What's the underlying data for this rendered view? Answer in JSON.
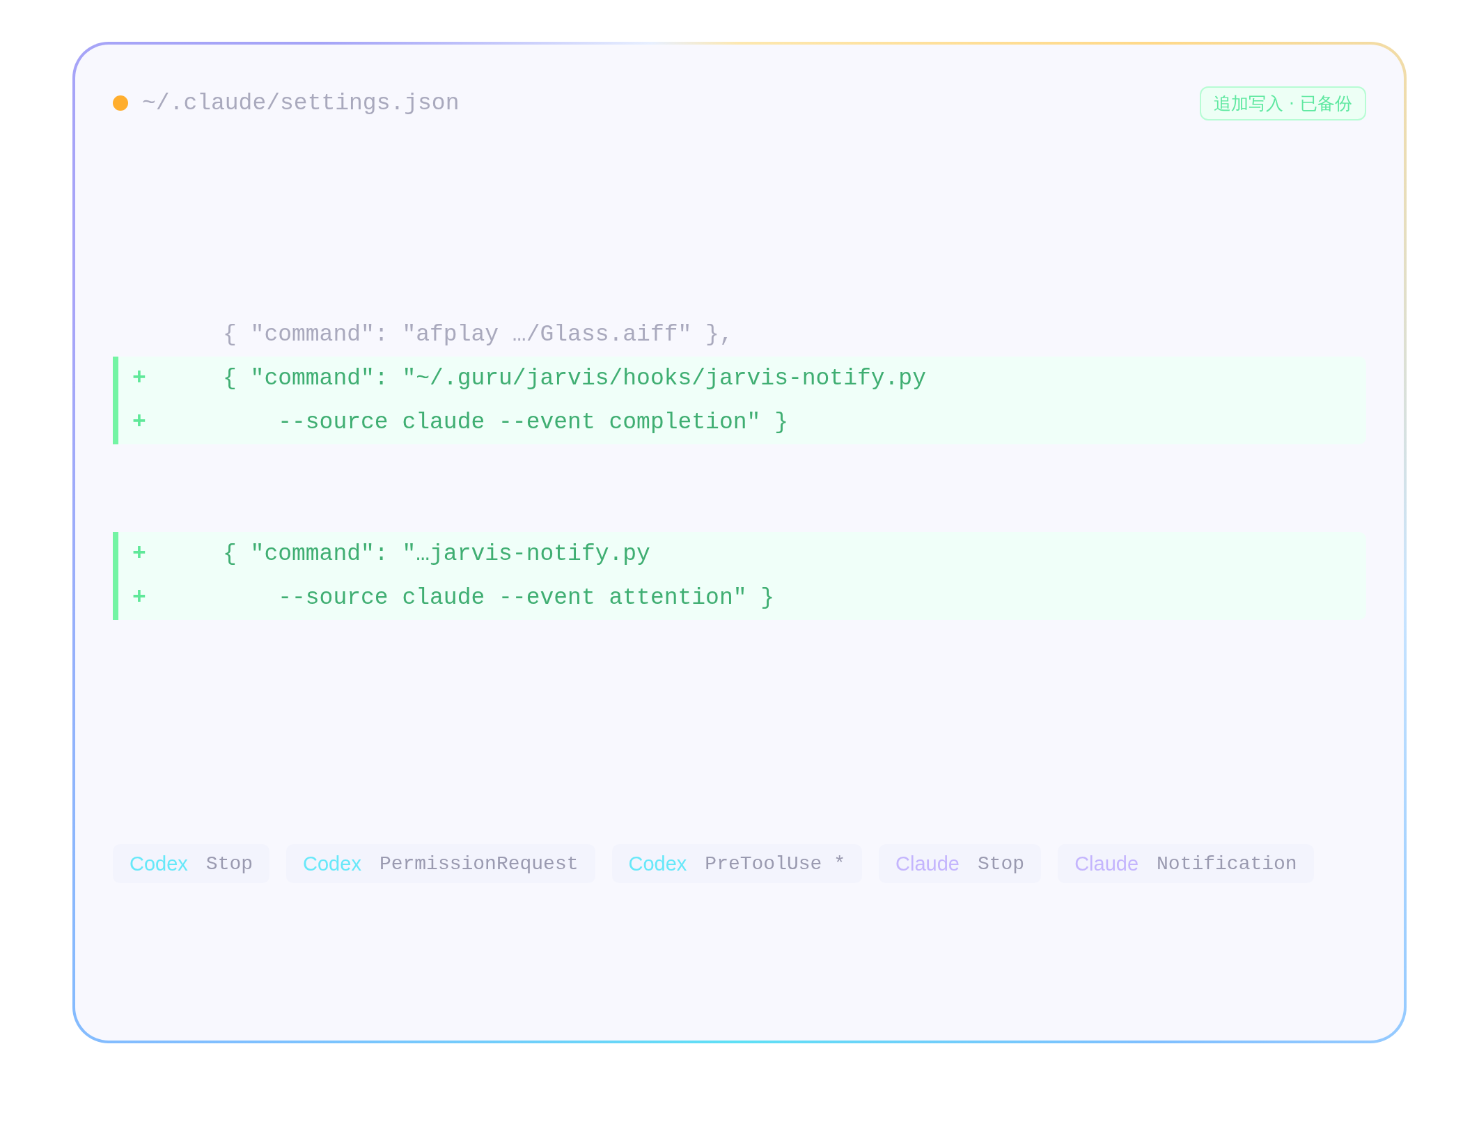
{
  "file": {
    "path": "~/.claude/settings.json"
  },
  "badge": "追加写入 · 已备份",
  "code_blocks": [
    {
      "kind": "context",
      "lines": [
        {
          "text": "{ \"command\": \"afplay …/Glass.aiff\" },"
        }
      ]
    },
    {
      "kind": "added",
      "lines": [
        {
          "marker": "+",
          "text": "{ \"command\": \"~/.guru/jarvis/hooks/jarvis-notify.py"
        },
        {
          "marker": "+",
          "text": "    --source claude --event completion\" }"
        }
      ]
    },
    {
      "kind": "added",
      "lines": [
        {
          "marker": "+",
          "text": "{ \"command\": \"…jarvis-notify.py"
        },
        {
          "marker": "+",
          "text": "    --source claude --event attention\" }"
        }
      ]
    }
  ],
  "events": [
    {
      "source": "Codex",
      "color": "#67e8f9",
      "event": "Stop"
    },
    {
      "source": "Codex",
      "color": "#67e8f9",
      "event": "PermissionRequest"
    },
    {
      "source": "Codex",
      "color": "#67e8f9",
      "event": "PreToolUse *"
    },
    {
      "source": "Claude",
      "color": "#c4b5fd",
      "event": "Stop"
    },
    {
      "source": "Claude",
      "color": "#c4b5fd",
      "event": "Notification"
    }
  ]
}
